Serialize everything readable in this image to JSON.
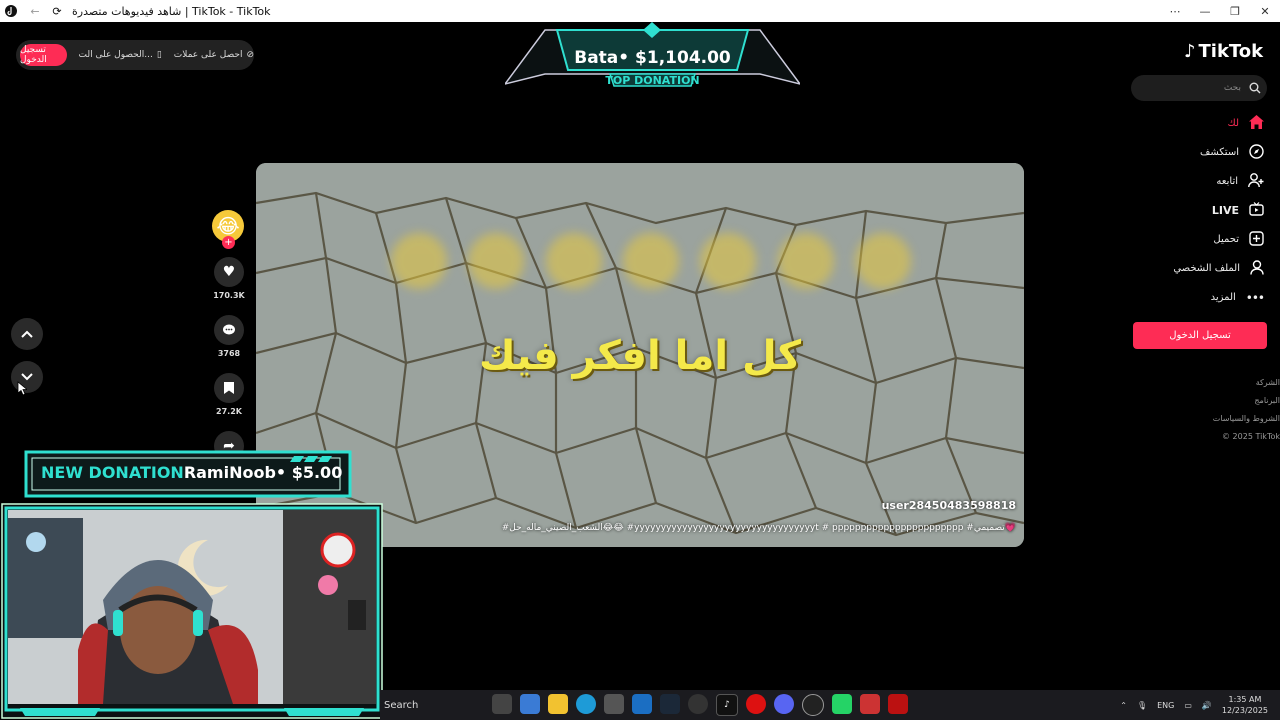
{
  "window": {
    "title": "شاهد فيديوهات متصدرة | TikTok - TikTok",
    "controls": [
      "⋯",
      "—",
      "❐",
      "✕"
    ]
  },
  "topbar": {
    "get_coins": "احصل على عملات",
    "get_app": "الحصول على الت...",
    "login": "تسجيل الدخول"
  },
  "top_donation": {
    "amount": "Bata• $1,104.00",
    "label": "TOP DONATION"
  },
  "video": {
    "caption": "كل اما افكر فيك",
    "username": "user28450483598818",
    "description": "#الشعب_الصيني_ماله_حل😂😂 #yyyyyyyyyyyyyyyyyyyyyyyyyyyyyyyyyyt # ppppppppppppppppppppppp #تصميمي💗"
  },
  "actions": {
    "likes": "170.3K",
    "comments": "3768",
    "saves": "27.2K"
  },
  "sidebar": {
    "logo": "TikTok",
    "search_placeholder": "بحث",
    "items": [
      {
        "label": "لك",
        "icon": "home-icon"
      },
      {
        "label": "استكشف",
        "icon": "compass-icon"
      },
      {
        "label": "اتابعه",
        "icon": "following-icon"
      },
      {
        "label": "LIVE",
        "icon": "live-icon"
      },
      {
        "label": "تحميل",
        "icon": "upload-icon"
      },
      {
        "label": "الملف الشخصي",
        "icon": "profile-icon"
      },
      {
        "label": "المزيد",
        "icon": "more-icon"
      }
    ],
    "login_button": "تسجيل الدخول",
    "footer": [
      "الشركة",
      "البرنامج",
      "الشروط والسياسات",
      "© 2025 TikTok"
    ]
  },
  "new_donation": {
    "label": "NEW DONATION",
    "donor": "RamiNoob• $5.00"
  },
  "taskbar": {
    "search": "Search",
    "language": "ENG",
    "time": "1:35 AM",
    "date": "12/23/2025"
  },
  "colors": {
    "accent": "#fe2c55",
    "donation_teal": "#2fe0d0"
  }
}
